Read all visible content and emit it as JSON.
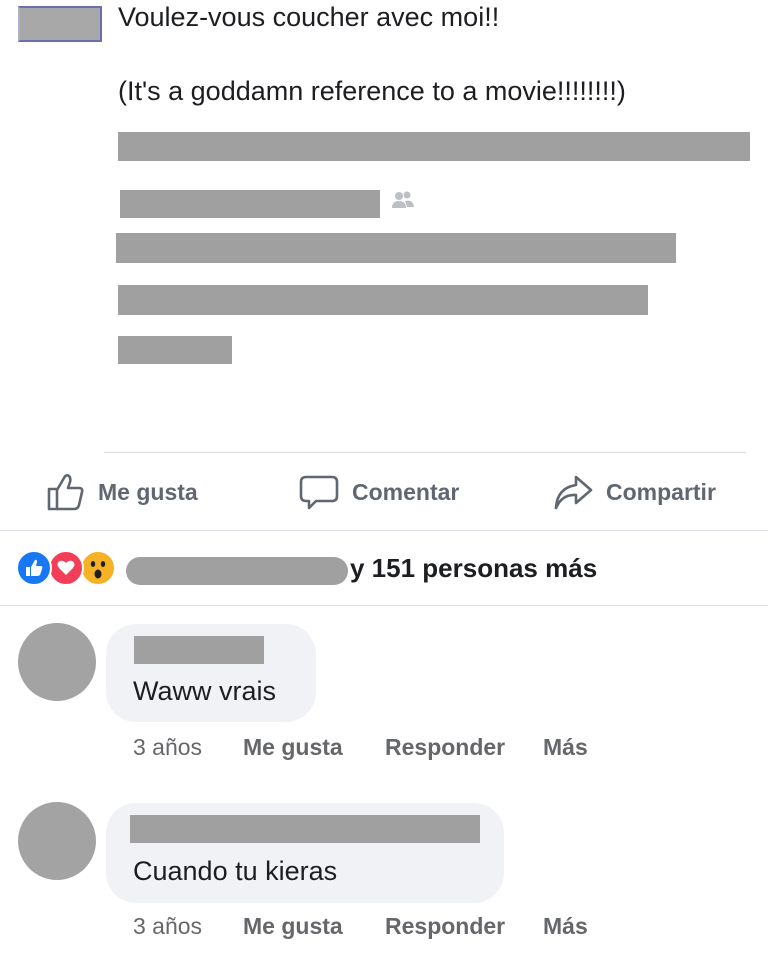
{
  "post": {
    "line1": "Voulez-vous coucher avec moi!!",
    "line2": "(It's a goddamn reference to a movie!!!!!!!!)"
  },
  "actions": {
    "like": "Me gusta",
    "comment": "Comentar",
    "share": "Compartir"
  },
  "reactions": {
    "types": [
      "like",
      "love",
      "wow"
    ],
    "summary": "y 151 personas más"
  },
  "comments": [
    {
      "text": "Waww vrais",
      "time": "3 años",
      "like": "Me gusta",
      "reply": "Responder",
      "more": "Más"
    },
    {
      "text": "Cuando tu kieras",
      "time": "3 años",
      "like": "Me gusta",
      "reply": "Responder",
      "more": "Más"
    }
  ],
  "colors": {
    "like_blue": "#1877f2",
    "love_red": "#f33e58",
    "wow_yellow": "#f7b125",
    "action_gray": "#606770",
    "bubble_bg": "#f0f2f5",
    "redacted": "#a0a0a0"
  }
}
